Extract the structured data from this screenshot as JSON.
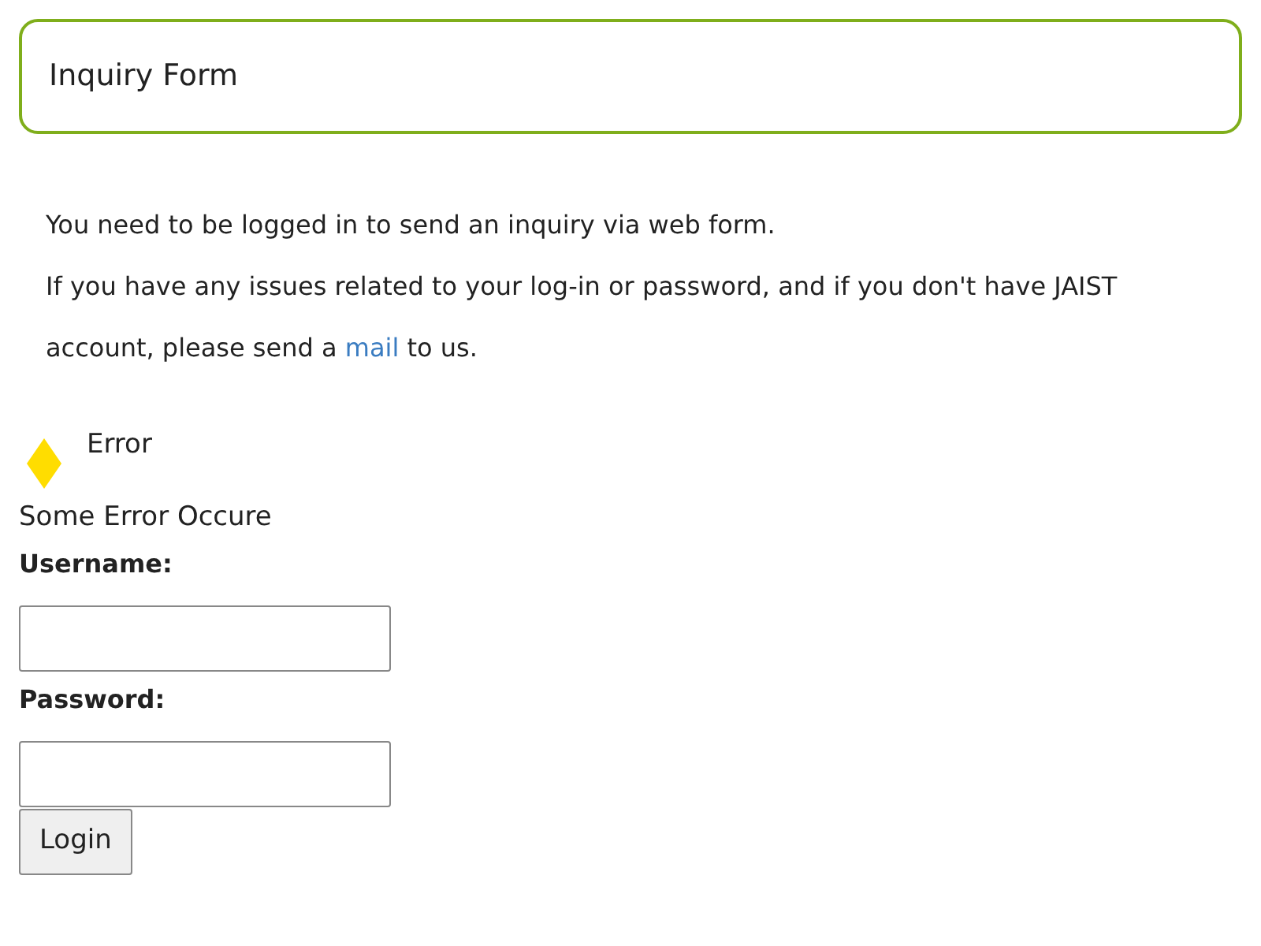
{
  "header": {
    "title": "Inquiry Form"
  },
  "intro": {
    "line_1": "You need to be logged in to send an inquiry via web form.",
    "line_2_before": "If you have any issues related to your log-in or password, and if you don't have JAIST account, please send a",
    "link": "mail",
    "line_2_after": "to us."
  },
  "error": {
    "title": "Error",
    "message": "Some Error Occure"
  },
  "form": {
    "fields": [
      {
        "label": "Username:"
      },
      {
        "label": "Password:"
      }
    ],
    "button": "Login"
  }
}
